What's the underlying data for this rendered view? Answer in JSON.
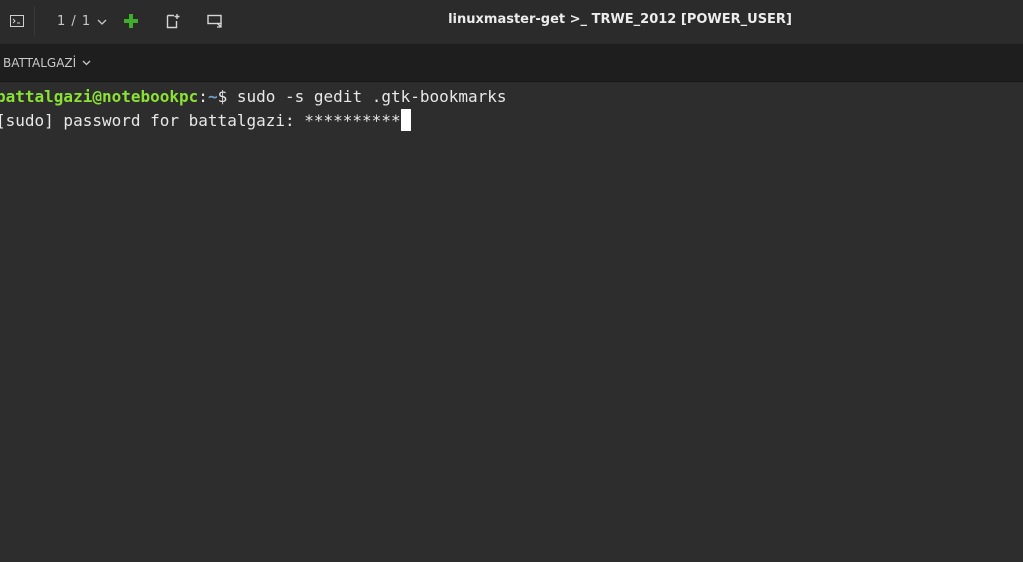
{
  "window": {
    "title": "linuxmaster-get >_ TRWE_2012 [POWER_USER]",
    "tab_counter": "1 / 1"
  },
  "toolbar": {
    "app_icon": "terminal-icon",
    "add_icon": "plus-icon",
    "split_icon": "split-terminal-icon",
    "broadcast_icon": "broadcast-icon"
  },
  "tab": {
    "label": "BATTALGAZİ"
  },
  "terminal": {
    "lines": [
      {
        "user_host": "battalgazi@notebookpc",
        "separator": ":",
        "path": "~",
        "prompt": "$ ",
        "command": "sudo -s gedit .gtk-bookmarks"
      },
      {
        "text": "[sudo] password for battalgazi: **********"
      }
    ]
  },
  "colors": {
    "background": "#2d2d2d",
    "prompt_user": "#8ae234",
    "prompt_path": "#729fcf",
    "text": "#e8e8e8",
    "add_button": "#3fae2a"
  }
}
